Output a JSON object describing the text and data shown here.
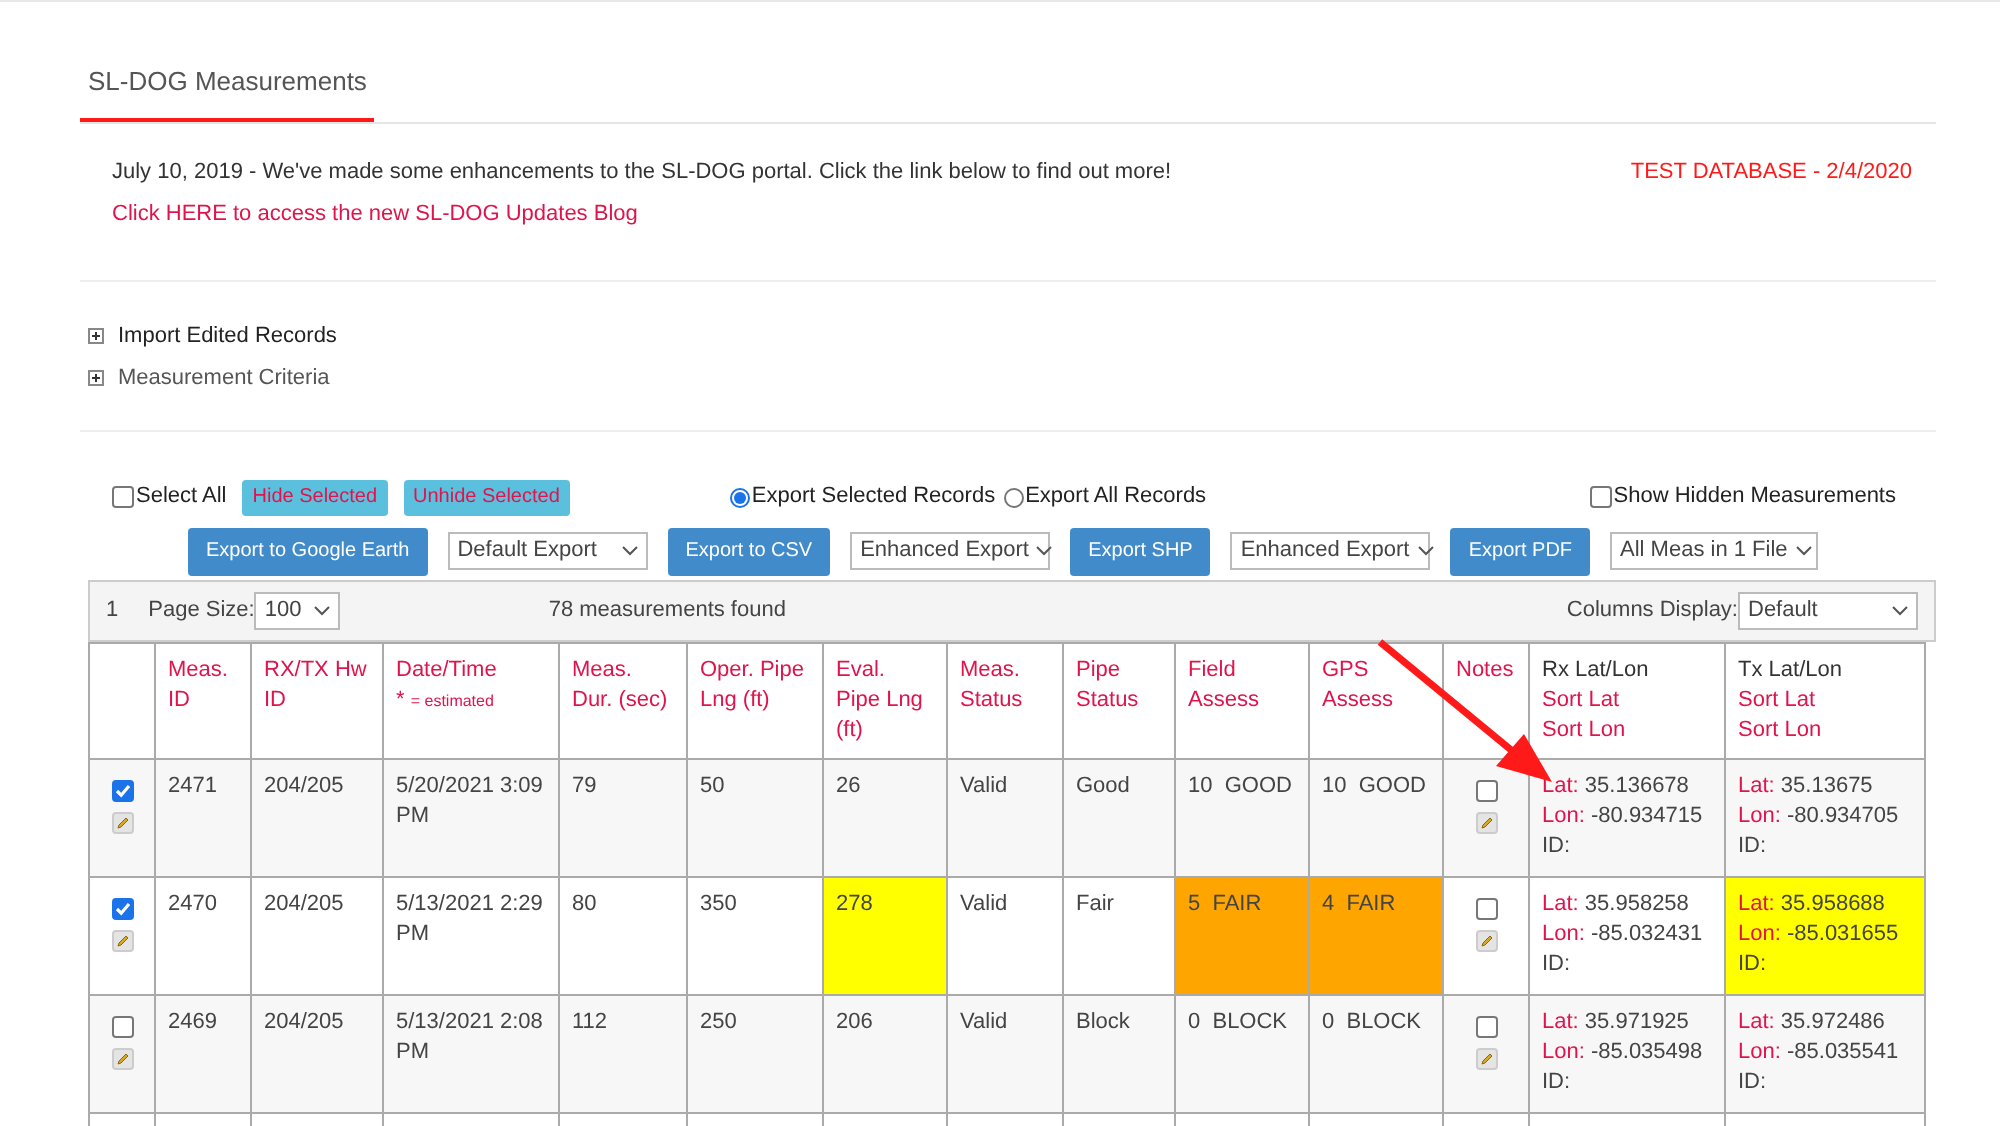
{
  "tab": {
    "label": "SL-DOG Measurements",
    "selected": true
  },
  "notice": {
    "text": "July 10, 2019 - We've made some enhancements to the SL-DOG portal. Click the link below to find out more!",
    "link": "Click HERE to access the new SL-DOG Updates Blog",
    "database": "TEST DATABASE - 2/4/2020"
  },
  "sections": [
    {
      "label": "Import Edited Records",
      "expanded": false
    },
    {
      "label": "Measurement Criteria",
      "expanded": false
    }
  ],
  "controls": {
    "select_all": {
      "label": "Select All",
      "checked": false
    },
    "hide_button": "Hide Selected",
    "unhide_button": "Unhide Selected",
    "export_options": [
      {
        "label": "Export Selected Records",
        "selected": true
      },
      {
        "label": "Export All Records",
        "selected": false
      }
    ],
    "show_hidden": {
      "label": "Show Hidden Measurements",
      "checked": false
    }
  },
  "exports": [
    {
      "button": "Export to Google Earth",
      "select": "Default Export"
    },
    {
      "button": "Export to CSV",
      "select": "Enhanced Export"
    },
    {
      "button": "Export SHP",
      "select": "Enhanced Export"
    },
    {
      "button": "Export PDF",
      "select": "All Meas in 1 File"
    }
  ],
  "pager": {
    "page": "1",
    "page_size_label": "Page Size:",
    "page_size": "100",
    "count": "78 measurements found",
    "columns_label": "Columns Display:",
    "columns_value": "Default"
  },
  "table": {
    "columns": [
      {
        "label": "Meas. ID"
      },
      {
        "label": "RX/TX Hw ID"
      },
      {
        "label": "Date/Time",
        "note_mark": "*",
        "note": "= estimated"
      },
      {
        "label": "Meas. Dur. (sec)"
      },
      {
        "label": "Oper. Pipe Lng (ft)"
      },
      {
        "label": "Eval. Pipe Lng (ft)"
      },
      {
        "label": "Meas. Status"
      },
      {
        "label": "Pipe Status"
      },
      {
        "label": "Field Assess"
      },
      {
        "label": "GPS Assess"
      },
      {
        "label": "Notes"
      },
      {
        "label": "Rx Lat/Lon",
        "sort_lat": "Sort Lat",
        "sort_lon": "Sort Lon"
      },
      {
        "label": "Tx Lat/Lon",
        "sort_lat": "Sort Lat",
        "sort_lon": "Sort Lon"
      }
    ],
    "rows": [
      {
        "selected": true,
        "cells": [
          {
            "text": "2471"
          },
          {
            "text": "204/205"
          },
          {
            "text": "5/20/2021 3:09 PM"
          },
          {
            "text": "79"
          },
          {
            "text": "50"
          },
          {
            "text": "26"
          },
          {
            "text": "Valid"
          },
          {
            "text": "Good"
          },
          {
            "text": "10  GOOD"
          },
          {
            "text": "10  GOOD"
          }
        ],
        "notes_checked": false,
        "rx": {
          "lat_label": "Lat:",
          "lat": "35.136678",
          "lon_label": "Lon:",
          "lon": "-80.934715",
          "id_label": "ID:"
        },
        "tx": {
          "lat_label": "Lat:",
          "lat": "35.13675",
          "lon_label": "Lon:",
          "lon": "-80.934705",
          "id_label": "ID:"
        }
      },
      {
        "selected": true,
        "cells": [
          {
            "text": "2470"
          },
          {
            "text": "204/205"
          },
          {
            "text": "5/13/2021 2:29 PM"
          },
          {
            "text": "80"
          },
          {
            "text": "350"
          },
          {
            "text": "278",
            "color": "#ffff00"
          },
          {
            "text": "Valid"
          },
          {
            "text": "Fair"
          },
          {
            "text": "5  FAIR",
            "color": "#ffa500"
          },
          {
            "text": "4  FAIR",
            "color": "#ffa500"
          }
        ],
        "notes_checked": false,
        "rx": {
          "lat_label": "Lat:",
          "lat": "35.958258",
          "lon_label": "Lon:",
          "lon": "-85.032431",
          "id_label": "ID:"
        },
        "tx": {
          "lat_label": "Lat:",
          "lat": "35.958688",
          "lon_label": "Lon:",
          "lon": "-85.031655",
          "id_label": "ID:",
          "color": "#ffff00"
        }
      },
      {
        "selected": false,
        "cells": [
          {
            "text": "2469"
          },
          {
            "text": "204/205"
          },
          {
            "text": "5/13/2021 2:08 PM"
          },
          {
            "text": "112"
          },
          {
            "text": "250"
          },
          {
            "text": "206"
          },
          {
            "text": "Valid"
          },
          {
            "text": "Block"
          },
          {
            "text": "0  BLOCK"
          },
          {
            "text": "0  BLOCK"
          }
        ],
        "notes_checked": false,
        "rx": {
          "lat_label": "Lat:",
          "lat": "35.971925",
          "lon_label": "Lon:",
          "lon": "-85.035498",
          "id_label": "ID:"
        },
        "tx": {
          "lat_label": "Lat:",
          "lat": "35.972486",
          "lon_label": "Lon:",
          "lon": "-85.035541",
          "id_label": "ID:"
        }
      }
    ]
  }
}
